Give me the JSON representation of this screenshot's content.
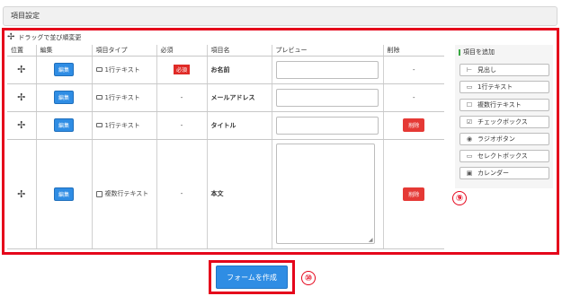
{
  "section": {
    "title": "項目設定"
  },
  "drag_note": "ドラッグで並び順変更",
  "table": {
    "headers": [
      "位置",
      "編集",
      "項目タイプ",
      "必須",
      "項目名",
      "プレビュー",
      "削除"
    ],
    "rows": [
      {
        "edit": "編集",
        "type": "1行テキスト",
        "type_icon": "single-line-icon",
        "required": "必須",
        "required_badge": true,
        "name": "お名前",
        "preview": "input",
        "delete": "-"
      },
      {
        "edit": "編集",
        "type": "1行テキスト",
        "type_icon": "single-line-icon",
        "required": "-",
        "required_badge": false,
        "name": "メールアドレス",
        "preview": "input",
        "delete": "-"
      },
      {
        "edit": "編集",
        "type": "1行テキスト",
        "type_icon": "single-line-icon",
        "required": "-",
        "required_badge": false,
        "name": "タイトル",
        "preview": "input",
        "delete": "削除"
      },
      {
        "edit": "編集",
        "type": "複数行テキスト",
        "type_icon": "multi-line-icon",
        "required": "-",
        "required_badge": false,
        "name": "本文",
        "preview": "textarea",
        "delete": "削除"
      }
    ]
  },
  "add_panel": {
    "title": "項目を追加",
    "buttons": [
      {
        "label": "見出し",
        "icon": "heading-icon",
        "glyph": "⊢"
      },
      {
        "label": "1行テキスト",
        "icon": "single-line-icon",
        "glyph": "▭"
      },
      {
        "label": "複数行テキスト",
        "icon": "multi-line-icon",
        "glyph": "☐"
      },
      {
        "label": "チェックボックス",
        "icon": "checkbox-icon",
        "glyph": "☑"
      },
      {
        "label": "ラジオボタン",
        "icon": "radio-icon",
        "glyph": "◉"
      },
      {
        "label": "セレクトボックス",
        "icon": "select-icon",
        "glyph": "▭"
      },
      {
        "label": "カレンダー",
        "icon": "calendar-icon",
        "glyph": "▣"
      }
    ]
  },
  "callouts": {
    "table": "⑨",
    "submit": "⑩"
  },
  "submit": {
    "label": "フォームを作成"
  },
  "colors": {
    "accent_red": "#e5051b",
    "button_blue": "#2f8de4",
    "delete_red": "#e53935"
  }
}
